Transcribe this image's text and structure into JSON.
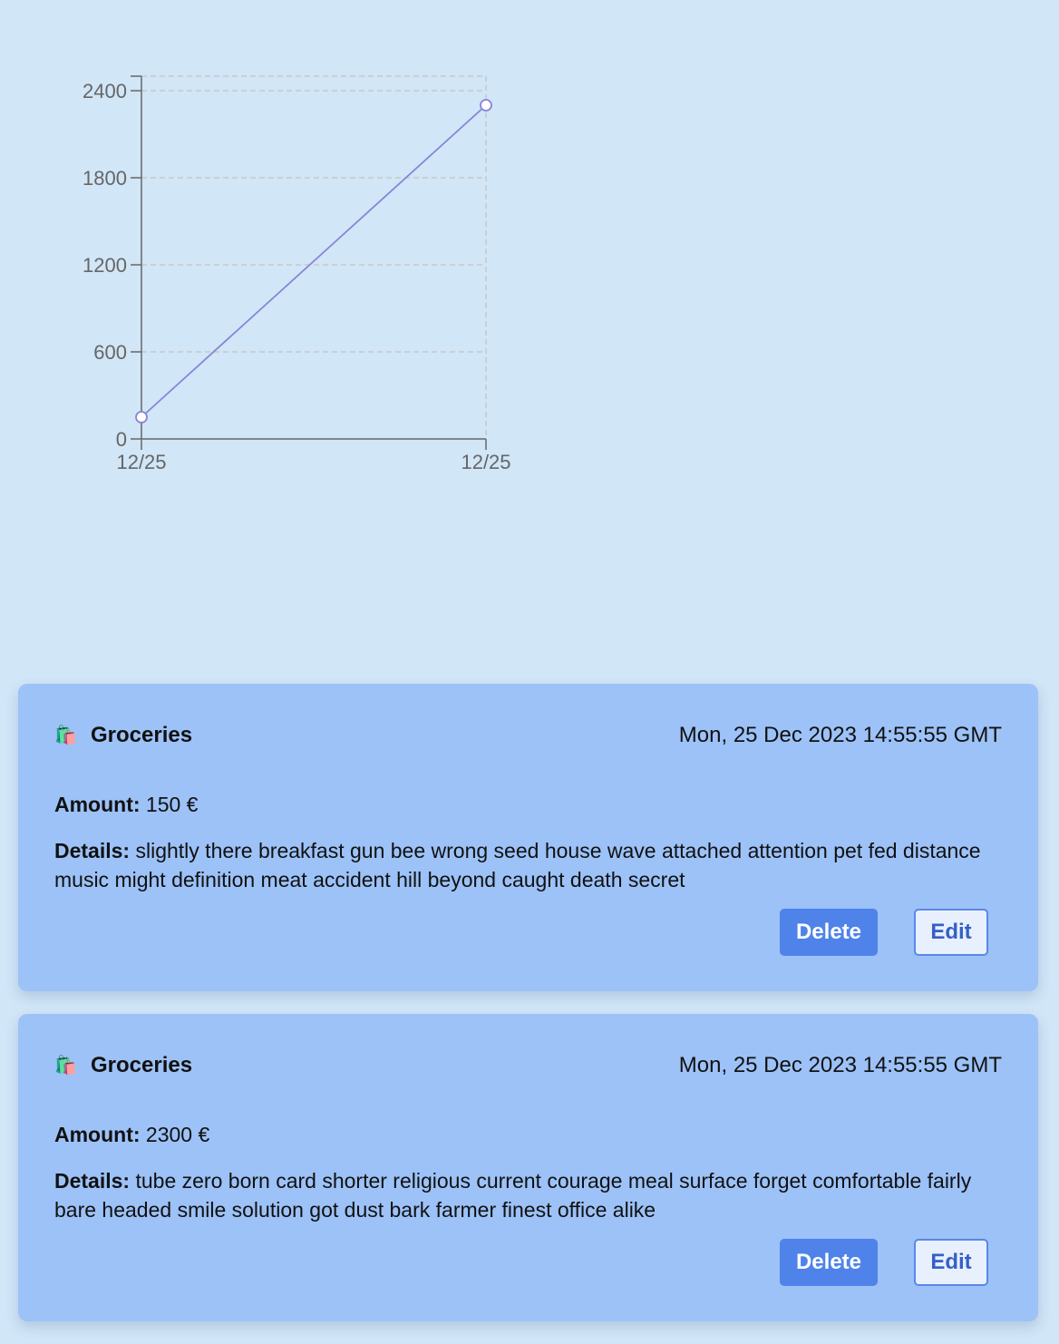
{
  "chart_data": {
    "type": "line",
    "x": [
      "12/25",
      "12/25"
    ],
    "series": [
      {
        "values": [
          150,
          2300
        ],
        "color": "#8884d8"
      }
    ],
    "y_ticks": [
      0,
      600,
      1200,
      1800,
      2400
    ],
    "x_tick_labels": [
      "12/25",
      "12/25"
    ],
    "ylim": [
      0,
      2400
    ],
    "grid": "dashed",
    "title": "",
    "xlabel": "",
    "ylabel": ""
  },
  "expenses": [
    {
      "icon": "shopping-bags-icon",
      "icon_glyph": "🛍️",
      "category": "Groceries",
      "date": "Mon, 25 Dec 2023 14:55:55 GMT",
      "amount_label": "Amount:",
      "amount": "150 €",
      "details_label": "Details:",
      "details": "slightly there breakfast gun bee wrong seed house wave attached attention pet fed distance music might definition meat accident hill beyond caught death secret",
      "delete_label": "Delete",
      "edit_label": "Edit"
    },
    {
      "icon": "shopping-bags-icon",
      "icon_glyph": "🛍️",
      "category": "Groceries",
      "date": "Mon, 25 Dec 2023 14:55:55 GMT",
      "amount_label": "Amount:",
      "amount": "2300 €",
      "details_label": "Details:",
      "details": "tube zero born card shorter religious current courage meal surface forget comfortable fairly bare headed smile solution got dust bark farmer finest office alike",
      "delete_label": "Delete",
      "edit_label": "Edit"
    }
  ],
  "colors": {
    "background": "#d1e6f7",
    "card": "#9cc2f8",
    "delete_button": "#4f83ea",
    "edit_text": "#3460c8",
    "line": "#8884d8"
  }
}
